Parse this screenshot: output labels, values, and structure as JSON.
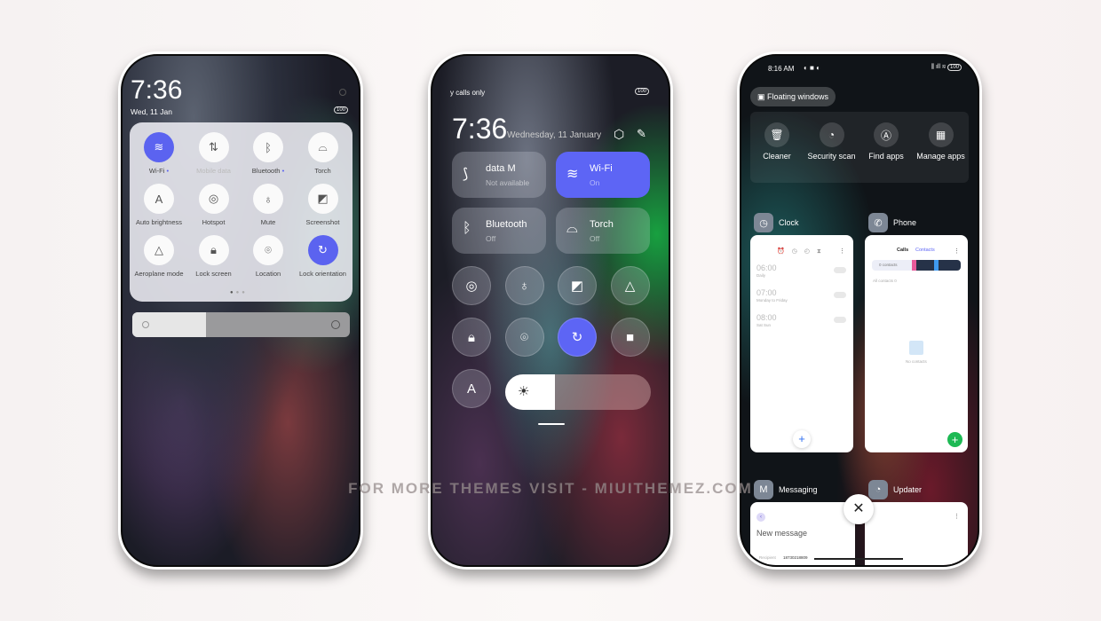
{
  "phone1": {
    "time": "7:36",
    "date": "Wed, 11 Jan",
    "battery": "100",
    "toggles": [
      {
        "label": "Wi-Fi",
        "icon": "wifi-icon",
        "on": true,
        "dot": true
      },
      {
        "label": "Mobile data",
        "icon": "mobile-data-icon",
        "on": false,
        "disabled": true
      },
      {
        "label": "Bluetooth",
        "icon": "bluetooth-icon",
        "on": false,
        "dot": true
      },
      {
        "label": "Torch",
        "icon": "torch-icon",
        "on": false
      },
      {
        "label": "Auto brightness",
        "icon": "auto-brightness-icon",
        "on": false
      },
      {
        "label": "Hotspot",
        "icon": "hotspot-icon",
        "on": false
      },
      {
        "label": "Mute",
        "icon": "bell-icon",
        "on": false
      },
      {
        "label": "Screenshot",
        "icon": "screenshot-icon",
        "on": false
      },
      {
        "label": "Aeroplane mode",
        "icon": "aeroplane-icon",
        "on": false
      },
      {
        "label": "Lock screen",
        "icon": "lock-icon",
        "on": false
      },
      {
        "label": "Location",
        "icon": "location-icon",
        "on": false
      },
      {
        "label": "Lock orientation",
        "icon": "rotation-lock-icon",
        "on": true
      }
    ],
    "page_count": 3,
    "brightness_percent": 34
  },
  "phone2": {
    "status": "y calls only",
    "battery": "100",
    "time": "7:36",
    "date": "Wednesday, 11 January",
    "tiles": [
      {
        "name": "data    M",
        "state": "Not available",
        "on": false
      },
      {
        "name": "Wi-Fi",
        "state": "On",
        "on": true
      },
      {
        "name": "Bluetooth",
        "state": "Off",
        "on": false
      },
      {
        "name": "Torch",
        "state": "Off",
        "on": false
      }
    ],
    "buttons": [
      "hotspot-icon",
      "bell-icon",
      "screenshot-icon",
      "aeroplane-icon",
      "lock-icon",
      "location-icon",
      "rotation-lock-icon",
      "video-camera-icon",
      "auto-brightness-icon"
    ],
    "brightness_percent": 34,
    "accent": "#5d65f5"
  },
  "phone3": {
    "status_time": "8:16 AM",
    "battery": "100",
    "floating_windows": "Floating windows",
    "tools": [
      "Cleaner",
      "Security scan",
      "Find apps",
      "Manage apps"
    ],
    "apps": [
      {
        "name": "Clock"
      },
      {
        "name": "Phone"
      },
      {
        "name": "Messaging"
      },
      {
        "name": "Updater"
      }
    ],
    "clock": {
      "alarms": [
        {
          "time": "06:00",
          "repeat": "Daily"
        },
        {
          "time": "07:00",
          "repeat": "Monday to Friday"
        },
        {
          "time": "08:00",
          "repeat": "Sat Sun"
        }
      ]
    },
    "phone_app": {
      "tabs": [
        "Calls",
        "Contacts"
      ],
      "contacts_chip": "0 contacts",
      "all_contacts": "All contacts  0",
      "empty": "No contacts"
    },
    "messaging": {
      "title": "New message",
      "recipient_label": "Recipient",
      "recipient": "18730218809"
    }
  },
  "watermark": "FOR MORE THEMES VISIT - MIUITHEMEZ.COM"
}
